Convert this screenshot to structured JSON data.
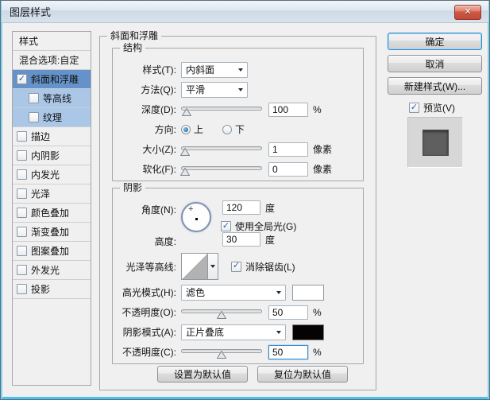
{
  "window": {
    "title": "图层样式"
  },
  "icons": {
    "close": "✕",
    "check": "✓",
    "crosshair": "+"
  },
  "colors": {
    "selection_blue": "#6593c9",
    "sub_selection_blue": "#aac7e7",
    "window_border_cyan": "#5ecdf0",
    "close_button_red": "#c64f3a",
    "highlight_swatch": "#ffffff",
    "shadow_swatch": "#060305",
    "preview_inner_gray": "#5f5f5f"
  },
  "sidebar": {
    "items": [
      {
        "label": "样式"
      },
      {
        "label": "混合选项:自定"
      },
      {
        "label": "斜面和浮雕",
        "checked": true,
        "selected": true
      },
      {
        "label": "等高线",
        "checked": false
      },
      {
        "label": "纹理",
        "checked": false
      },
      {
        "label": "描边",
        "checked": false
      },
      {
        "label": "内阴影",
        "checked": false
      },
      {
        "label": "内发光",
        "checked": false
      },
      {
        "label": "光泽",
        "checked": false
      },
      {
        "label": "颜色叠加",
        "checked": false
      },
      {
        "label": "渐变叠加",
        "checked": false
      },
      {
        "label": "图案叠加",
        "checked": false
      },
      {
        "label": "外发光",
        "checked": false
      },
      {
        "label": "投影",
        "checked": false
      }
    ]
  },
  "panel": {
    "title": "斜面和浮雕",
    "structure": {
      "title": "结构",
      "style_label": "样式(T):",
      "style_value": "内斜面",
      "technique_label": "方法(Q):",
      "technique_value": "平滑",
      "depth_label": "深度(D):",
      "depth_value": "100",
      "depth_unit": "%",
      "direction_label": "方向:",
      "direction_up": "上",
      "direction_down": "下",
      "size_label": "大小(Z):",
      "size_value": "1",
      "size_unit": "像素",
      "soften_label": "软化(F):",
      "soften_value": "0",
      "soften_unit": "像素"
    },
    "shading": {
      "title": "阴影",
      "angle_label": "角度(N):",
      "angle_value": "120",
      "angle_unit": "度",
      "use_global_light_label": "使用全局光(G)",
      "altitude_label": "高度:",
      "altitude_value": "30",
      "altitude_unit": "度",
      "gloss_contour_label": "光泽等高线:",
      "anti_alias_label": "消除锯齿(L)",
      "highlight_mode_label": "高光模式(H):",
      "highlight_mode_value": "滤色",
      "highlight_opacity_label": "不透明度(O):",
      "highlight_opacity_value": "50",
      "highlight_opacity_unit": "%",
      "shadow_mode_label": "阴影模式(A):",
      "shadow_mode_value": "正片叠底",
      "shadow_opacity_label": "不透明度(C):",
      "shadow_opacity_value": "50",
      "shadow_opacity_unit": "%"
    },
    "footer": {
      "set_default": "设置为默认值",
      "reset_default": "复位为默认值"
    }
  },
  "actions": {
    "ok": "确定",
    "cancel": "取消",
    "new_style": "新建样式(W)...",
    "preview_label": "预览(V)"
  }
}
